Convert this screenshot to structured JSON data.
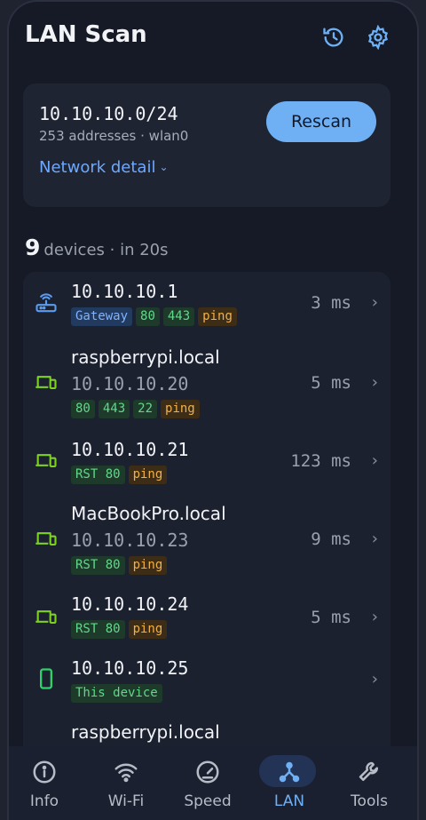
{
  "header": {
    "title": "LAN Scan",
    "history_icon": "history-icon",
    "settings_icon": "gear-icon"
  },
  "network": {
    "subnet": "10.10.10.0/24",
    "meta": "253 addresses · wlan0",
    "detail_label": "Network detail",
    "rescan_label": "Rescan"
  },
  "summary": {
    "count": "9",
    "text": "devices · in 20s"
  },
  "devices": [
    {
      "icon": "router-icon",
      "host": "10.10.10.1",
      "ip": "",
      "tags": [
        "Gateway",
        "80",
        "443",
        "ping"
      ],
      "latency": "3 ms"
    },
    {
      "icon": "computer-icon",
      "host": "raspberrypi.local",
      "ip": "10.10.10.20",
      "tags": [
        "80",
        "443",
        "22",
        "ping"
      ],
      "latency": "5 ms"
    },
    {
      "icon": "computer-icon",
      "host": "10.10.10.21",
      "ip": "",
      "tags": [
        "RST 80",
        "ping"
      ],
      "latency": "123 ms"
    },
    {
      "icon": "computer-icon",
      "host": "MacBookPro.local",
      "ip": "10.10.10.23",
      "tags": [
        "RST 80",
        "ping"
      ],
      "latency": "9 ms"
    },
    {
      "icon": "computer-icon",
      "host": "10.10.10.24",
      "ip": "",
      "tags": [
        "RST 80",
        "ping"
      ],
      "latency": "5 ms"
    },
    {
      "icon": "phone-icon",
      "host": "10.10.10.25",
      "ip": "",
      "tags": [
        "This device"
      ],
      "latency": ""
    },
    {
      "icon": "",
      "host": "raspberrypi.local",
      "ip": "",
      "tags": [],
      "latency": ""
    }
  ],
  "nav": [
    {
      "label": "Info",
      "icon": "info-icon",
      "active": false
    },
    {
      "label": "Wi-Fi",
      "icon": "wifi-icon",
      "active": false
    },
    {
      "label": "Speed",
      "icon": "speedometer-icon",
      "active": false
    },
    {
      "label": "LAN",
      "icon": "lan-icon",
      "active": true
    },
    {
      "label": "Tools",
      "icon": "wrench-icon",
      "active": false
    }
  ],
  "colors": {
    "accent": "#6fb0f5",
    "device_green": "#7ed321",
    "router_blue": "#5b9cf0",
    "this_device_green": "#2fd16a"
  }
}
